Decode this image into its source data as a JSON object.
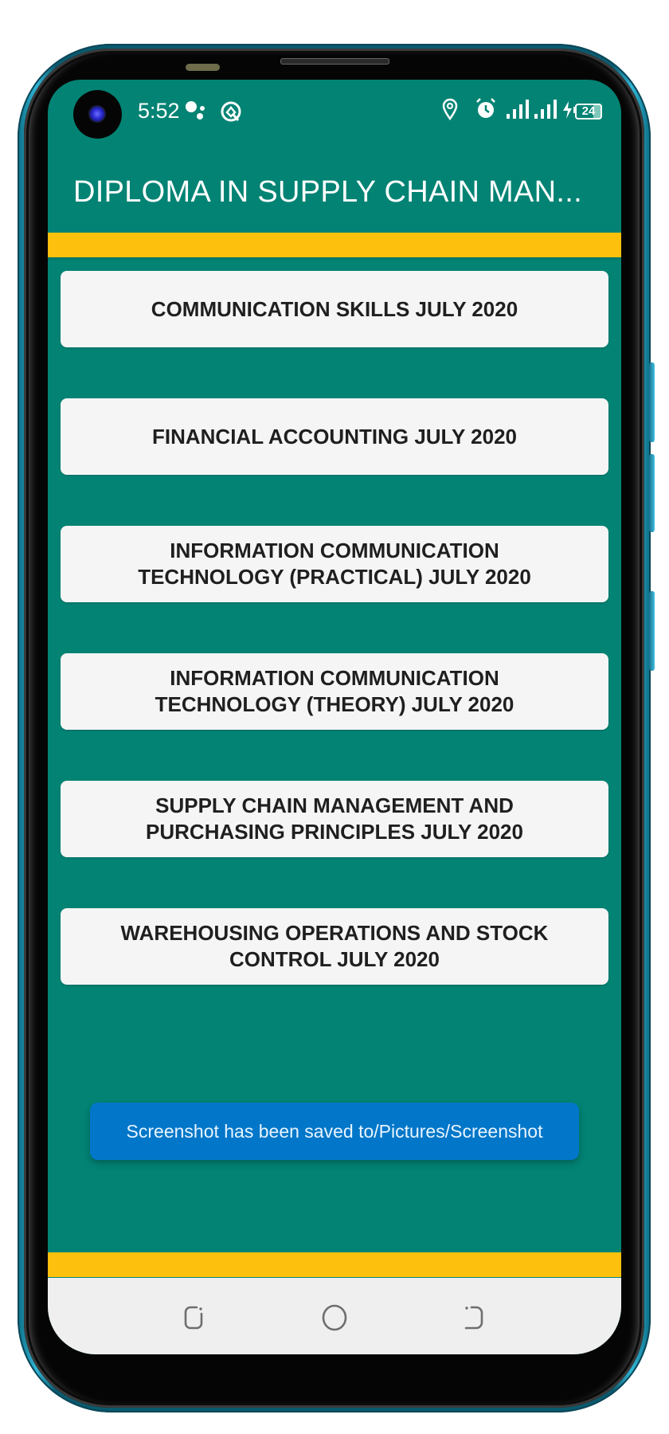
{
  "status_bar": {
    "time": "5:52",
    "icons": [
      "assistant-dots-icon",
      "screen-recorder-icon",
      "location-icon",
      "alarm-icon",
      "signal-1-icon",
      "signal-2-icon",
      "charging-icon",
      "battery-icon"
    ],
    "battery_level": "24"
  },
  "app_bar": {
    "title": "DIPLOMA IN SUPPLY CHAIN MAN...",
    "background_color": "#028374",
    "accent_bar_color": "#fdc10d"
  },
  "subjects": [
    {
      "label": "COMMUNICATION SKILLS JULY 2020"
    },
    {
      "label": "FINANCIAL ACCOUNTING JULY 2020"
    },
    {
      "label": "INFORMATION COMMUNICATION\nTECHNOLOGY (PRACTICAL)  JULY 2020"
    },
    {
      "label": "INFORMATION COMMUNICATION\nTECHNOLOGY (THEORY)  JULY 2020"
    },
    {
      "label": "SUPPLY CHAIN MANAGEMENT AND\nPURCHASING PRINCIPLES  JULY 2020"
    },
    {
      "label": "WAREHOUSING OPERATIONS AND STOCK\nCONTROL  JULY 2020"
    }
  ],
  "toast": {
    "message": "Screenshot has been saved to/Pictures/Screenshot",
    "color": "#0277c9"
  },
  "nav_bar": {
    "buttons": [
      "recents",
      "home",
      "back"
    ]
  }
}
